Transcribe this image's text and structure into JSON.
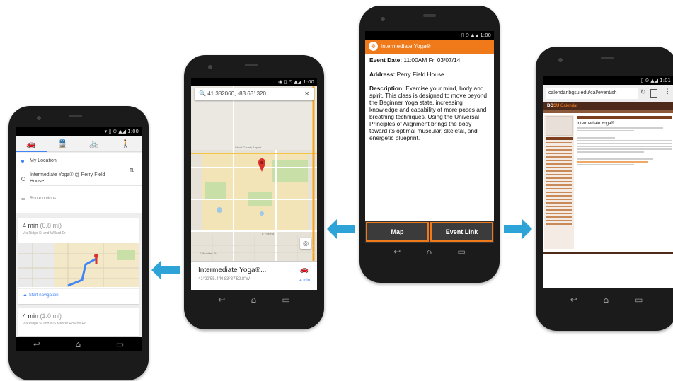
{
  "status": {
    "time1": "1:00",
    "time2": "1:00",
    "time3": "1:00",
    "time4": "1:01"
  },
  "directions": {
    "from": "My Location",
    "to": "Intermediate Yoga® @ Perry Field House",
    "route_options": "Route options",
    "routes": [
      {
        "minutes": "4 min",
        "distance": "(0.8 mi)",
        "via": "Via Ridge St and Willard Dr"
      },
      {
        "minutes": "4 min",
        "distance": "(1.0 mi)",
        "via": "Via Ridge St and N/S Mercer Rd/Poe Rd"
      }
    ],
    "start_navigation": "Start navigation"
  },
  "map": {
    "search_value": "41.382060, -83.631320",
    "place_name": "Intermediate Yoga®...",
    "coords": "41°22'55.4\"N 83°37'52.8\"W",
    "drive_time": "4 min",
    "airport_label": "Wood County Airport",
    "road_label": "E Poe Rd",
    "road_label2": "E Wooster St"
  },
  "event": {
    "title": "Intermediate Yoga®",
    "date_label": "Event Date:",
    "date_value": "11:00AM Fri 03/07/14",
    "address_label": "Address:",
    "address_value": "Perry Field House",
    "desc_label": "Description:",
    "desc_value": "Exercise your mind, body and spirit. This class is designed to move beyond the Beginner Yoga state, increasing knowledge and capability of more poses and breathing techniques. Using the Universal Principles of Alignment brings the body toward its optimal muscular, skeletal, and energetic blueprint.",
    "map_button": "Map",
    "link_button": "Event Link"
  },
  "browser": {
    "url": "calendar.bgsu.edu/cal/event/sh",
    "brand_bg": "BG",
    "brand_su": "SU",
    "brand_title": "Calendar",
    "event_title": "Intermediate Yoga®"
  },
  "colors": {
    "accent": "#f07a1a",
    "arrow": "#2ea3d8",
    "map_blue": "#4285f4"
  }
}
